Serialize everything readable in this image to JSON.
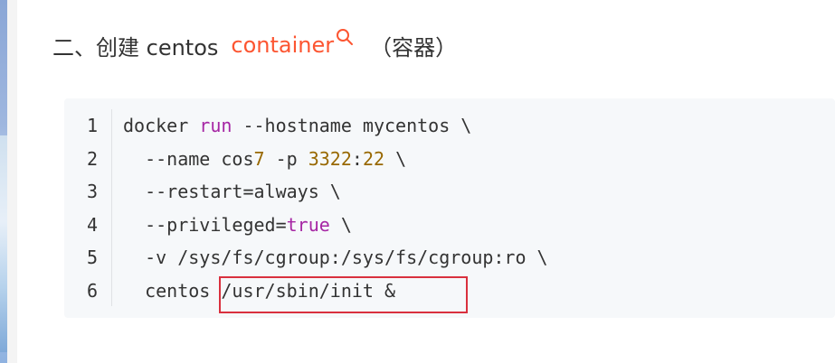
{
  "heading": {
    "prefix": "二、创建 centos",
    "link": "container",
    "suffix": "（容器）"
  },
  "code": {
    "line_numbers": [
      "1",
      "2",
      "3",
      "4",
      "5",
      "6"
    ],
    "lines": [
      [
        {
          "t": "docker ",
          "c": "plain"
        },
        {
          "t": "run",
          "c": "kw"
        },
        {
          "t": " --hostname mycentos \\",
          "c": "plain"
        }
      ],
      [
        {
          "t": "  --name cos",
          "c": "plain"
        },
        {
          "t": "7",
          "c": "num"
        },
        {
          "t": " -p ",
          "c": "plain"
        },
        {
          "t": "3322",
          "c": "num"
        },
        {
          "t": ":",
          "c": "plain"
        },
        {
          "t": "22",
          "c": "num"
        },
        {
          "t": " \\",
          "c": "plain"
        }
      ],
      [
        {
          "t": "  --restart=always \\",
          "c": "plain"
        }
      ],
      [
        {
          "t": "  --privileged=",
          "c": "plain"
        },
        {
          "t": "true",
          "c": "kw"
        },
        {
          "t": " \\",
          "c": "plain"
        }
      ],
      [
        {
          "t": "  -v /sys/fs/cgroup:/sys/fs/cgroup:ro \\",
          "c": "plain"
        }
      ],
      [
        {
          "t": "  centos /usr/sbin/init &",
          "c": "plain"
        }
      ]
    ]
  },
  "colors": {
    "link": "#fc5531",
    "keyword": "#a626a4",
    "number": "#986801",
    "highlight_box": "#d9303e",
    "code_background": "#f6f8fa"
  },
  "icons": {
    "link_search": "search-icon"
  }
}
